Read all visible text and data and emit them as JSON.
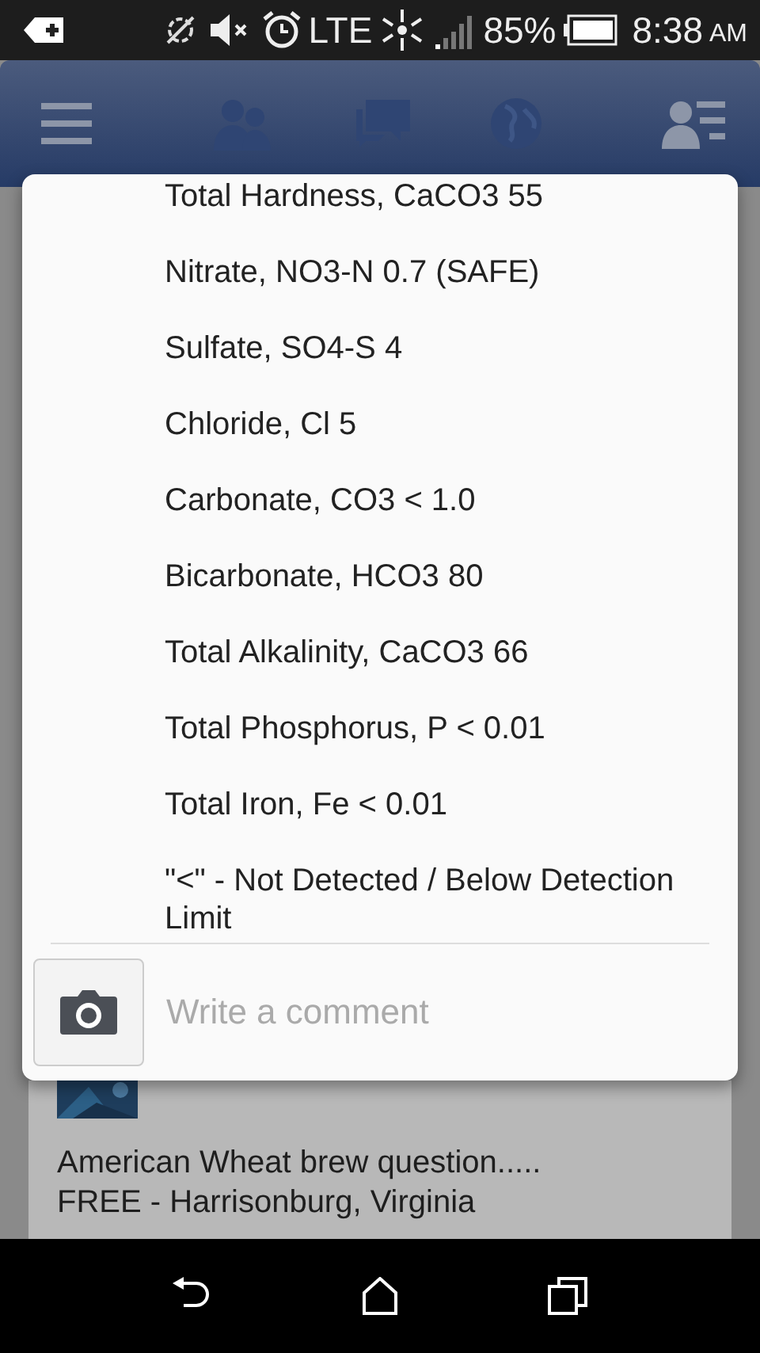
{
  "status_bar": {
    "network": "LTE",
    "battery": "85%",
    "time": "8:38",
    "meridiem": "AM"
  },
  "dialog": {
    "lines": [
      "Total Hardness, CaCO3 55",
      "Nitrate, NO3-N 0.7 (SAFE)",
      "Sulfate, SO4-S 4",
      "Chloride, Cl 5",
      "Carbonate, CO3 < 1.0",
      "Bicarbonate, HCO3 80",
      "Total Alkalinity, CaCO3 66",
      "Total Phosphorus, P < 0.01",
      "Total Iron, Fe < 0.01",
      "\"<\" - Not Detected / Below Detection Limit"
    ],
    "comment": {
      "placeholder": "Write a comment"
    }
  },
  "post": {
    "text": [
      "American Wheat brew question.....",
      "FREE - Harrisonburg, Virginia"
    ]
  }
}
